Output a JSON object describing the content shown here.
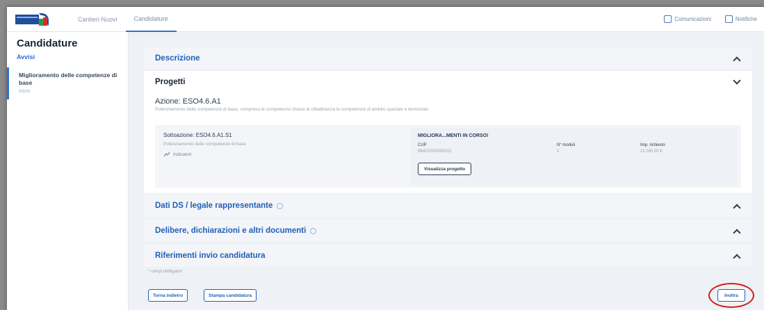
{
  "topbar": {
    "tabs": [
      {
        "label": "Cantieri Nuovi"
      },
      {
        "label": "Candidature"
      }
    ],
    "right_items": [
      {
        "label": "Comunicazioni",
        "icon": "chat-icon"
      },
      {
        "label": "Notifiche",
        "icon": "bell-icon"
      }
    ]
  },
  "sidebar": {
    "title": "Candidature",
    "subtitle": "Avvisi",
    "item": {
      "label": "Miglioramento delle competenze di base",
      "sub": "Inizio"
    }
  },
  "sections": {
    "descrizione": "Descrizione",
    "progetti": "Progetti",
    "dati_ds": "Dati DS / legale rappresentante",
    "delibere": "Delibere, dichiarazioni e altri documenti",
    "riferimenti": "Riferimenti invio candidatura"
  },
  "progetti": {
    "azione": "Azione: ESO4.6.A1",
    "azione_desc": "Potenziamento delle competenze di base, compreso le competenze chiave di cittadinanza le competenze di ambito spaziale e territoriale",
    "sottoazione": "Sottoazione: ESO4.6.A1.S1",
    "sottoazione_desc": "Potenziamento delle competenze di base",
    "indicatori": "Indicatori",
    "card": {
      "title": "MIGLIORA...MENTI IN CORSO!",
      "cup_label": "CUP",
      "cup_value": "B84C0000000012",
      "moduli_label": "N° moduli",
      "moduli_value": "2",
      "imp_label": "Imp. richiesto",
      "imp_value": "12.160,00 €",
      "visualizza": "Visualizza progetto"
    }
  },
  "footer": {
    "note": "* campi obbligatori",
    "torna": "Torna indietro",
    "stampa": "Stampa candidatura",
    "inoltra": "Inoltra"
  },
  "colors": {
    "accent": "#2060b8",
    "highlight_ring": "#d11a1a",
    "page_bg": "#eef1f5"
  }
}
